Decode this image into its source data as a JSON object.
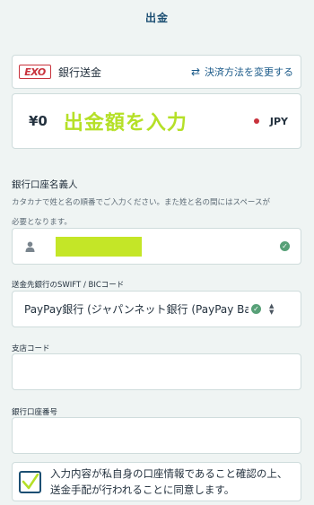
{
  "header": {
    "title": "出金"
  },
  "payment_method": {
    "logo_text": "EXO",
    "label": "銀行送金",
    "change_label": "決済方法を変更する"
  },
  "amount": {
    "currency_symbol_value": "¥0",
    "placeholder": "出金額を入力",
    "currency": "JPY"
  },
  "account_holder": {
    "label": "銀行口座名義人",
    "help_line1": "カタカナで姓と名の順番でご入力ください。また姓と名の間にはスペースが",
    "help_line2": "必要となります。"
  },
  "swift": {
    "label": "送金先銀行のSWIFT / BICコード",
    "value": "PayPay銀行 (ジャパンネット銀行 (PayPay Bank))"
  },
  "branch": {
    "label": "支店コード",
    "value": ""
  },
  "account_number": {
    "label": "銀行口座番号",
    "value": ""
  },
  "agreement": {
    "checked": true,
    "text": "入力内容が私自身の口座情報であること確認の上、送金手配が行われることに同意します。"
  },
  "colors": {
    "accent_green": "#b5e027",
    "brand_navy": "#1c4f73",
    "logo_red": "#c8323c",
    "valid_green": "#57a077"
  }
}
